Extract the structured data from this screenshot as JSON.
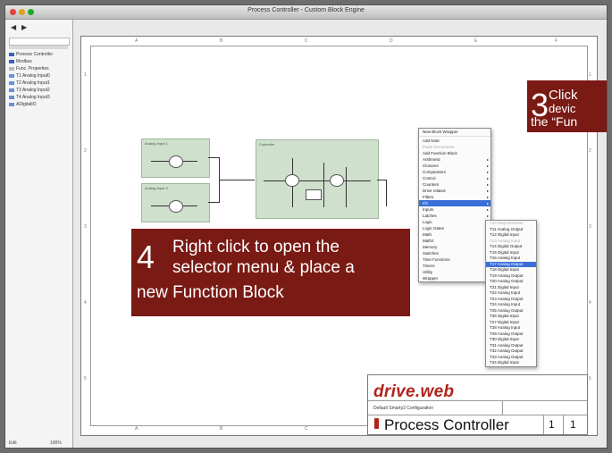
{
  "window": {
    "title": "Process Controller - Custom Block Engine"
  },
  "sidebar": {
    "items": [
      {
        "label": "Process Controller",
        "color": "#3a5fc0"
      },
      {
        "label": "Modbus",
        "color": "#3a5fc0"
      },
      {
        "label": "Func. Properties",
        "color": "#bbbbbb"
      },
      {
        "label": "T1 Analog Input0",
        "color": "#6a8fd8"
      },
      {
        "label": "T2 Analog Input1",
        "color": "#6a8fd8"
      },
      {
        "label": "T3 Analog Input2",
        "color": "#6a8fd8"
      },
      {
        "label": "T4 Analog Input3",
        "color": "#6a8fd8"
      },
      {
        "label": "ADigitalIO",
        "color": "#6a8fd8"
      }
    ],
    "status_left": "Edit",
    "status_right": "100%"
  },
  "sheet": {
    "col_refs": [
      "A",
      "B",
      "C",
      "D",
      "E",
      "F"
    ],
    "row_refs": [
      "1",
      "2",
      "3",
      "4",
      "5"
    ]
  },
  "blocks": [
    {
      "label": "Analog Input 1"
    },
    {
      "label": "Analog Input 2"
    },
    {
      "label": "Controller"
    }
  ],
  "context_menu": {
    "items": [
      {
        "label": "New Block Wrapper",
        "arrow": "",
        "dim": false,
        "hl": false
      },
      {
        "label": "",
        "sep": true
      },
      {
        "label": "Add Note",
        "arrow": "",
        "dim": false,
        "hl": false
      },
      {
        "label": "Paste Documents",
        "arrow": "",
        "dim": true,
        "hl": false
      },
      {
        "label": "Add Function Block",
        "arrow": "",
        "dim": false,
        "hl": false
      },
      {
        "label": "Arithmetic",
        "arrow": "▸",
        "dim": false,
        "hl": false
      },
      {
        "label": "Closures",
        "arrow": "▸",
        "dim": false,
        "hl": false
      },
      {
        "label": "Comparators",
        "arrow": "▸",
        "dim": false,
        "hl": false
      },
      {
        "label": "Control",
        "arrow": "▸",
        "dim": false,
        "hl": false
      },
      {
        "label": "Counters",
        "arrow": "▸",
        "dim": false,
        "hl": false
      },
      {
        "label": "Drive related",
        "arrow": "▸",
        "dim": false,
        "hl": false
      },
      {
        "label": "Filters",
        "arrow": "▸",
        "dim": false,
        "hl": false
      },
      {
        "label": "I/O",
        "arrow": "▸",
        "dim": false,
        "hl": true
      },
      {
        "label": "Inputs",
        "arrow": "▸",
        "dim": false,
        "hl": false
      },
      {
        "label": "Latches",
        "arrow": "▸",
        "dim": false,
        "hl": false
      },
      {
        "label": "Logic",
        "arrow": "▸",
        "dim": false,
        "hl": false
      },
      {
        "label": "Logic Gates",
        "arrow": "▸",
        "dim": false,
        "hl": false
      },
      {
        "label": "Math",
        "arrow": "▸",
        "dim": false,
        "hl": false
      },
      {
        "label": "Math2",
        "arrow": "▸",
        "dim": false,
        "hl": false
      },
      {
        "label": "Memory",
        "arrow": "▸",
        "dim": false,
        "hl": false
      },
      {
        "label": "Switches",
        "arrow": "▸",
        "dim": false,
        "hl": false
      },
      {
        "label": "Time Functions",
        "arrow": "▸",
        "dim": false,
        "hl": false
      },
      {
        "label": "Timers",
        "arrow": "▸",
        "dim": false,
        "hl": false
      },
      {
        "label": "Utility",
        "arrow": "▸",
        "dim": false,
        "hl": false
      },
      {
        "label": "Wrapper",
        "arrow": "▸",
        "dim": false,
        "hl": false
      }
    ]
  },
  "submenu": {
    "items": [
      {
        "label": "T10 Requirements",
        "dim": true,
        "hl": false
      },
      {
        "label": "T11 Analog Output",
        "dim": false,
        "hl": false
      },
      {
        "label": "T12 Digital Input",
        "dim": false,
        "hl": false
      },
      {
        "label": "T13 Analog Input",
        "dim": true,
        "hl": false
      },
      {
        "label": "T14 Digital Output",
        "dim": false,
        "hl": false
      },
      {
        "label": "T15 Digital Input",
        "dim": false,
        "hl": false
      },
      {
        "label": "T16 Analog Input",
        "dim": false,
        "hl": false
      },
      {
        "label": "T17 Analog Output",
        "dim": false,
        "hl": true
      },
      {
        "label": "T18 Digital Input",
        "dim": false,
        "hl": false
      },
      {
        "label": "T19 Analog Output",
        "dim": false,
        "hl": false
      },
      {
        "label": "T20 Analog Output",
        "dim": false,
        "hl": false
      },
      {
        "label": "T21 Digital Input",
        "dim": false,
        "hl": false
      },
      {
        "label": "T22 Analog Input",
        "dim": false,
        "hl": false
      },
      {
        "label": "T23 Analog Output",
        "dim": false,
        "hl": false
      },
      {
        "label": "T24 Analog Input",
        "dim": false,
        "hl": false
      },
      {
        "label": "T25 Analog Output",
        "dim": false,
        "hl": false
      },
      {
        "label": "T26 Digital Input",
        "dim": false,
        "hl": false
      },
      {
        "label": "T27 Digital Input",
        "dim": false,
        "hl": false
      },
      {
        "label": "T28 Analog Input",
        "dim": false,
        "hl": false
      },
      {
        "label": "T29 Analog Output",
        "dim": false,
        "hl": false
      },
      {
        "label": "T30 Digital Input",
        "dim": false,
        "hl": false
      },
      {
        "label": "T31 Analog Output",
        "dim": false,
        "hl": false
      },
      {
        "label": "T32 Analog Output",
        "dim": false,
        "hl": false
      },
      {
        "label": "T33 Analog Output",
        "dim": false,
        "hl": false
      },
      {
        "label": "T34 Digital Input",
        "dim": false,
        "hl": false
      }
    ]
  },
  "callout3": {
    "num": "3",
    "line1": "Click",
    "line2": "devic",
    "line3": "the “Fun"
  },
  "callout4": {
    "num": "4",
    "line1": "Right click to open the",
    "line2": "selector menu & place a",
    "line3": "new Function Block"
  },
  "title_block": {
    "logo": "drive.web",
    "subtitle": "Default Smarty2 Configuration",
    "name": "Process Controller",
    "sheet": "1",
    "of": "1"
  },
  "colors": {
    "callout": "#7a1a14",
    "logo": "#b2231c",
    "menu_highlight": "#3a6fd8",
    "block_fill": "#cfe0cd"
  }
}
